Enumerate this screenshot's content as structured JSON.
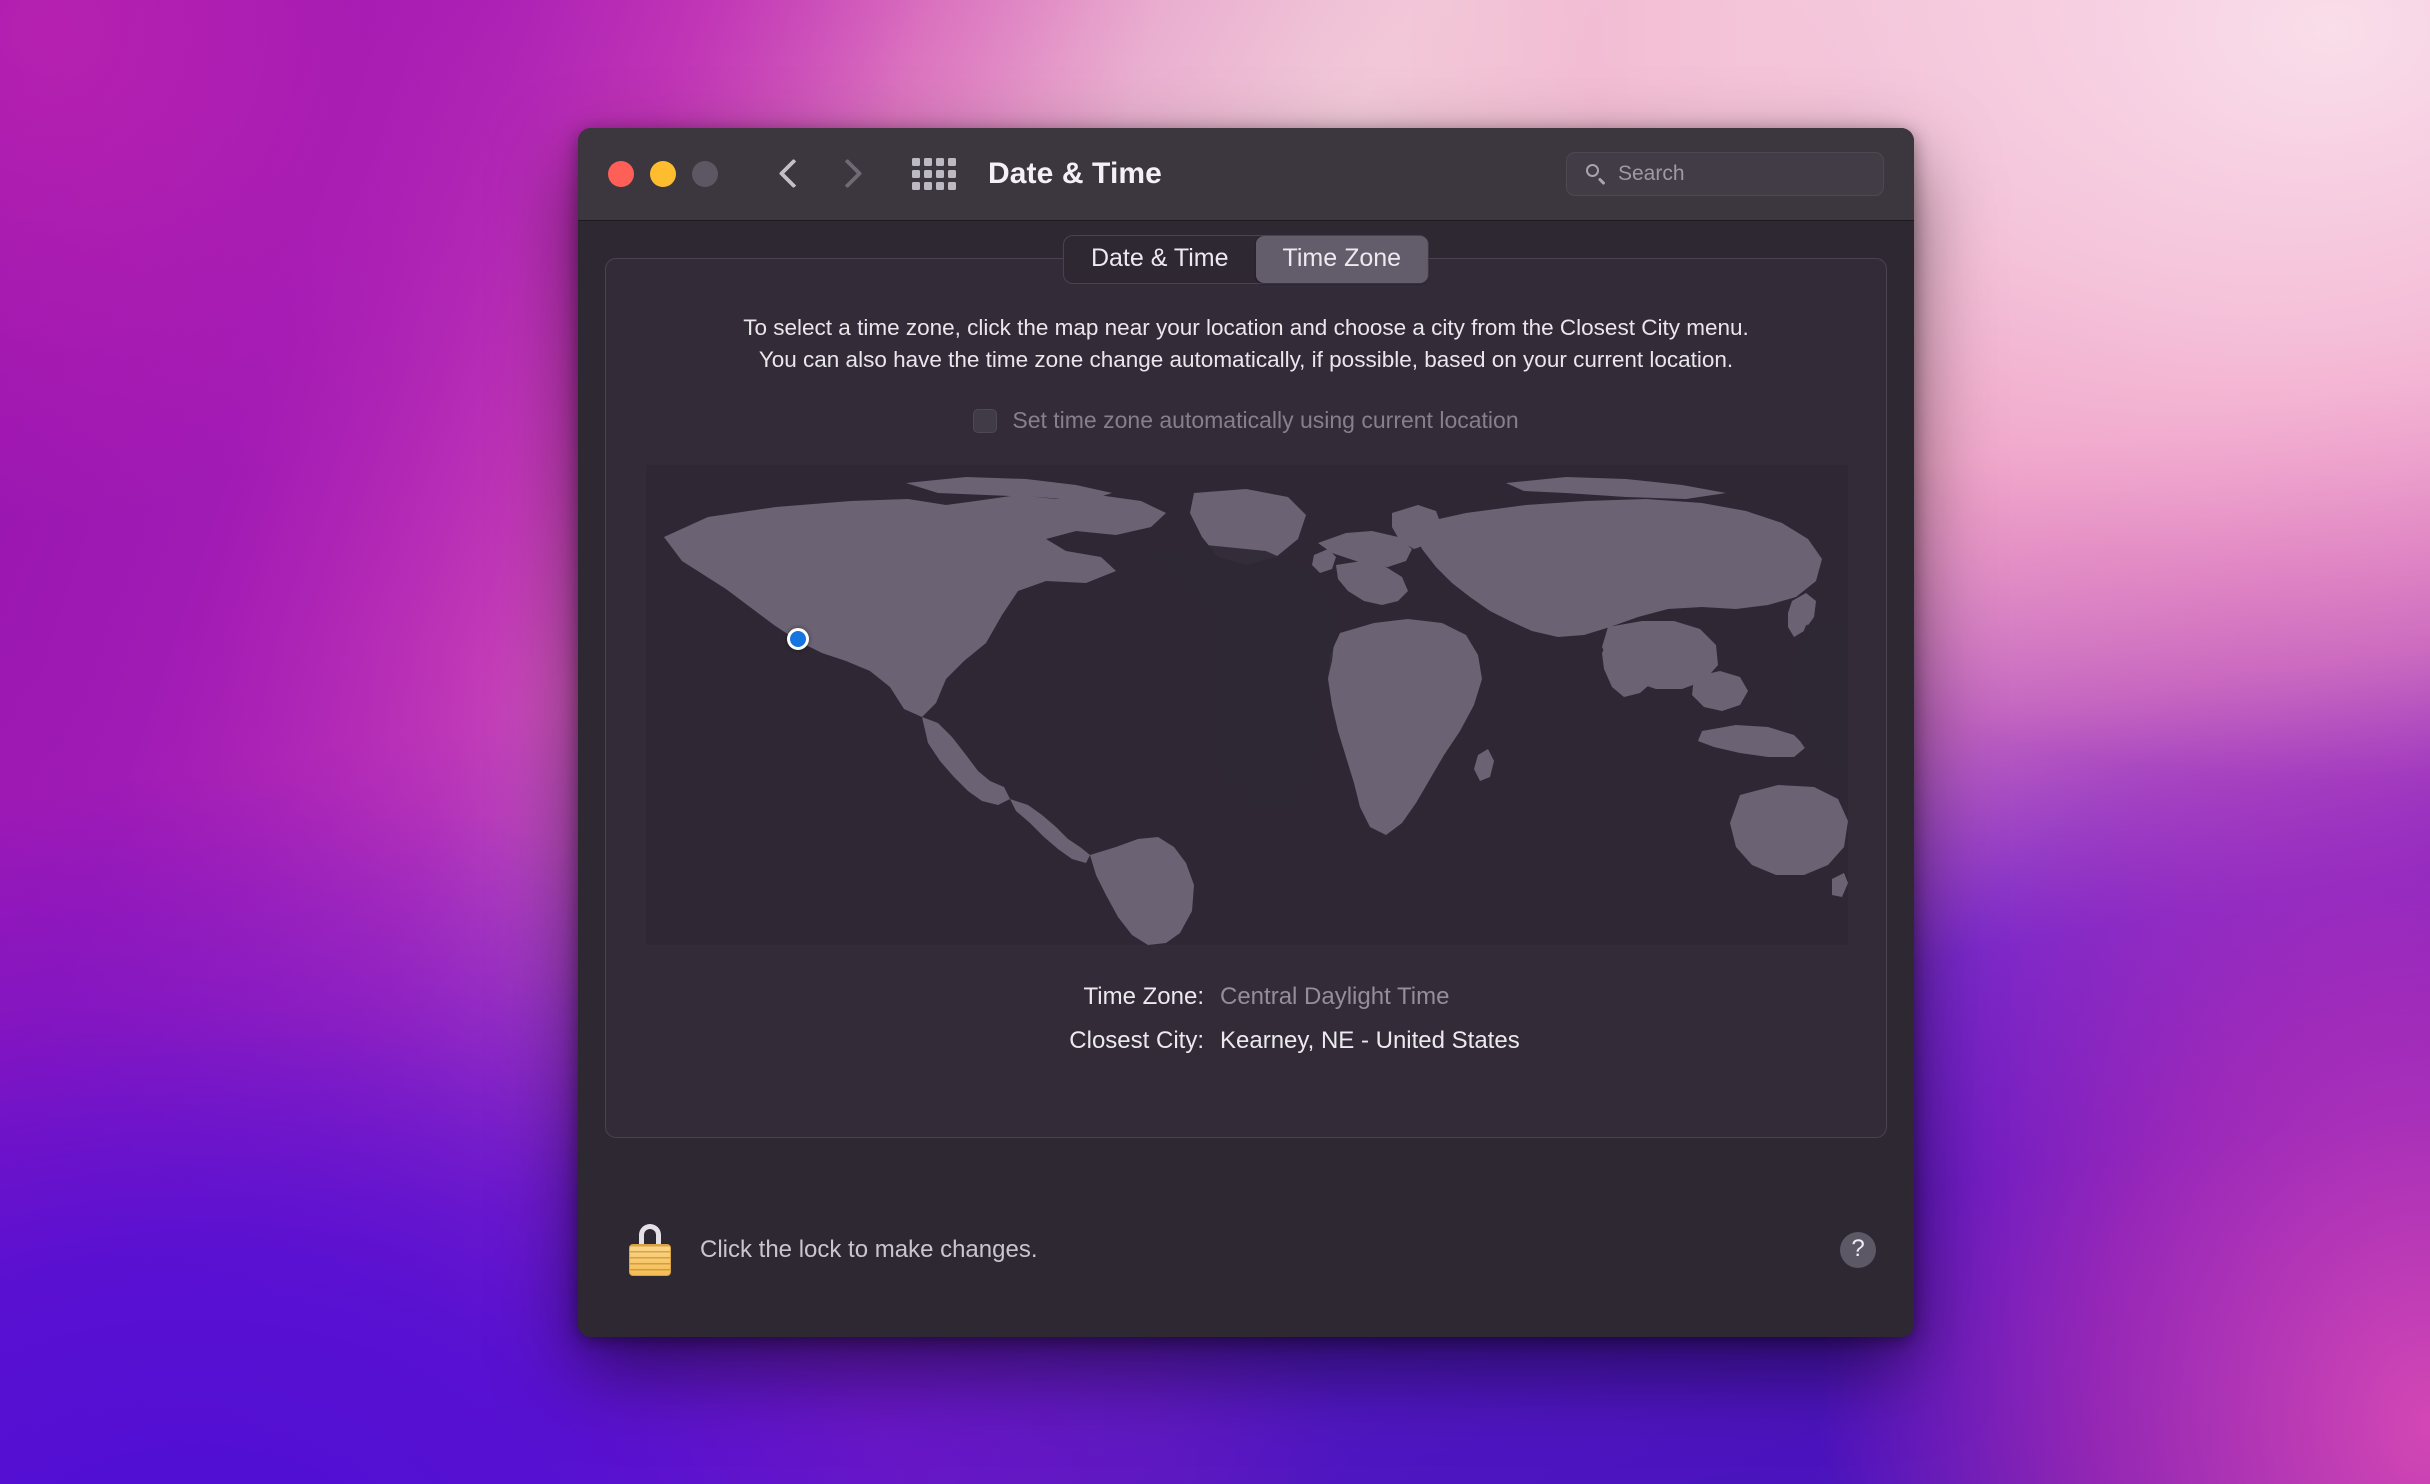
{
  "window": {
    "title": "Date & Time",
    "traffic_lights": [
      "close",
      "minimize",
      "zoom-disabled"
    ],
    "nav": {
      "back_icon": "chevron-left-icon",
      "forward_icon": "chevron-right-icon"
    },
    "grid_icon": "show-all-grid-icon"
  },
  "search": {
    "placeholder": "Search",
    "value": "",
    "icon": "search-icon"
  },
  "tabs": [
    {
      "label": "Date & Time",
      "active": false
    },
    {
      "label": "Time Zone",
      "active": true
    }
  ],
  "instructions": {
    "line1": "To select a time zone, click the map near your location and choose a city from the Closest City menu.",
    "line2": "You can also have the time zone change automatically, if possible, based on your current location."
  },
  "auto_timezone": {
    "label": "Set time zone automatically using current location",
    "checked": false,
    "enabled": false
  },
  "map": {
    "marker_icon": "location-marker-icon",
    "marker_color": "#1575e0",
    "land_color": "#6b6373",
    "ocean_color": "#2f2834"
  },
  "info": {
    "timezone_label": "Time Zone:",
    "timezone_value": "Central Daylight Time",
    "closest_city_label": "Closest City:",
    "closest_city_value": "Kearney, NE - United States"
  },
  "footer": {
    "lock_icon": "lock-closed-icon",
    "lock_text": "Click the lock to make changes.",
    "help_label": "?",
    "help_icon": "help-question-icon"
  }
}
